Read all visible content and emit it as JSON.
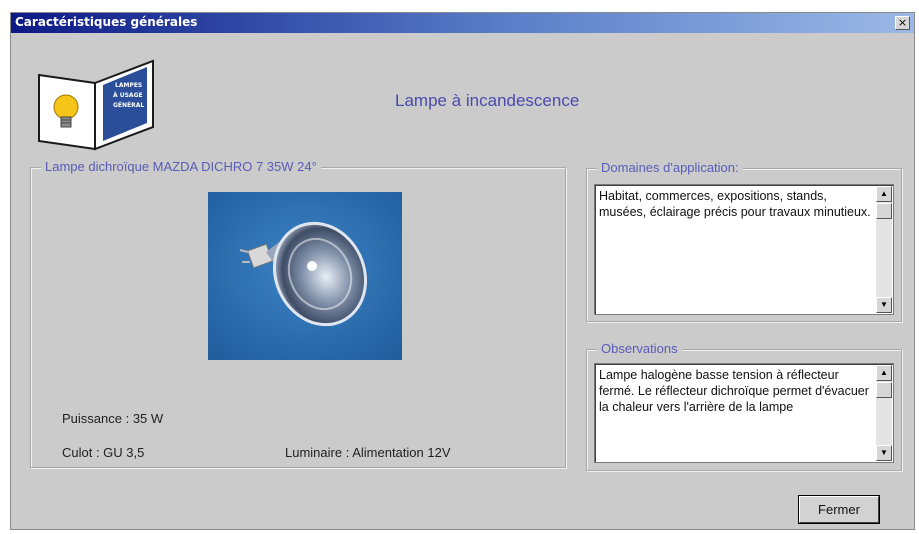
{
  "window": {
    "title": "Caractéristiques générales",
    "close_label": "×"
  },
  "header": {
    "title": "Lampe à incandescence",
    "book_text": [
      "LAMPES",
      "À USAGE",
      "GÉNÉRAL"
    ]
  },
  "product": {
    "group_label": "Lampe dichroïque  MAZDA  DICHRO 7 35W 24°",
    "puissance": "Puissance :  35 W",
    "culot": "Culot :   GU 3,5",
    "luminaire": "Luminaire : Alimentation 12V"
  },
  "domaines": {
    "label": "Domaines d'application:",
    "text": "Habitat, commerces, expositions, stands, musées, éclairage précis pour travaux minutieux."
  },
  "observations": {
    "label": "Observations",
    "text": "Lampe halogène basse tension à réflecteur fermé. Le réflecteur dichroïque permet d'évacuer la chaleur vers l'arrière de la lampe"
  },
  "buttons": {
    "close": "Fermer"
  },
  "colors": {
    "title_bar": "#0c1a86",
    "accent_text": "#4a4ab0",
    "photo_bg": "#2c6fb3"
  }
}
